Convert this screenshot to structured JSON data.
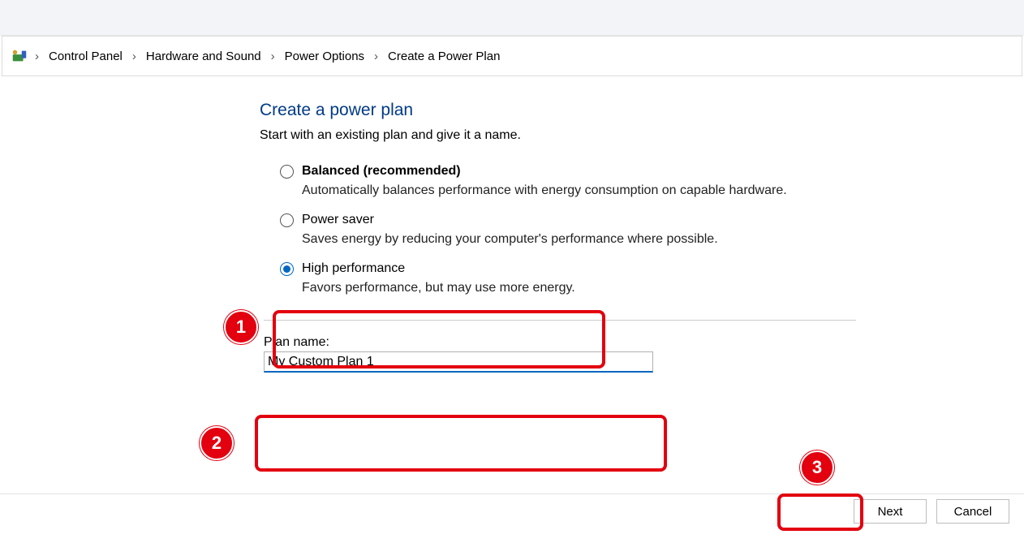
{
  "breadcrumb": {
    "items": [
      "Control Panel",
      "Hardware and Sound",
      "Power Options",
      "Create a Power Plan"
    ]
  },
  "page": {
    "title": "Create a power plan",
    "subtitle": "Start with an existing plan and give it a name."
  },
  "options": [
    {
      "label": "Balanced (recommended)",
      "desc": "Automatically balances performance with energy consumption on capable hardware.",
      "bold": true,
      "selected": false
    },
    {
      "label": "Power saver",
      "desc": "Saves energy by reducing your computer's performance where possible.",
      "bold": false,
      "selected": false
    },
    {
      "label": "High performance",
      "desc": "Favors performance, but may use more energy.",
      "bold": false,
      "selected": true
    }
  ],
  "plan": {
    "label": "Plan name:",
    "value": "My Custom Plan 1"
  },
  "buttons": {
    "next": "Next",
    "cancel": "Cancel"
  },
  "annotations": {
    "badge1": "1",
    "badge2": "2",
    "badge3": "3"
  },
  "colors": {
    "accent": "#0067c0",
    "annotation": "#E3000F",
    "title": "#003a87"
  }
}
